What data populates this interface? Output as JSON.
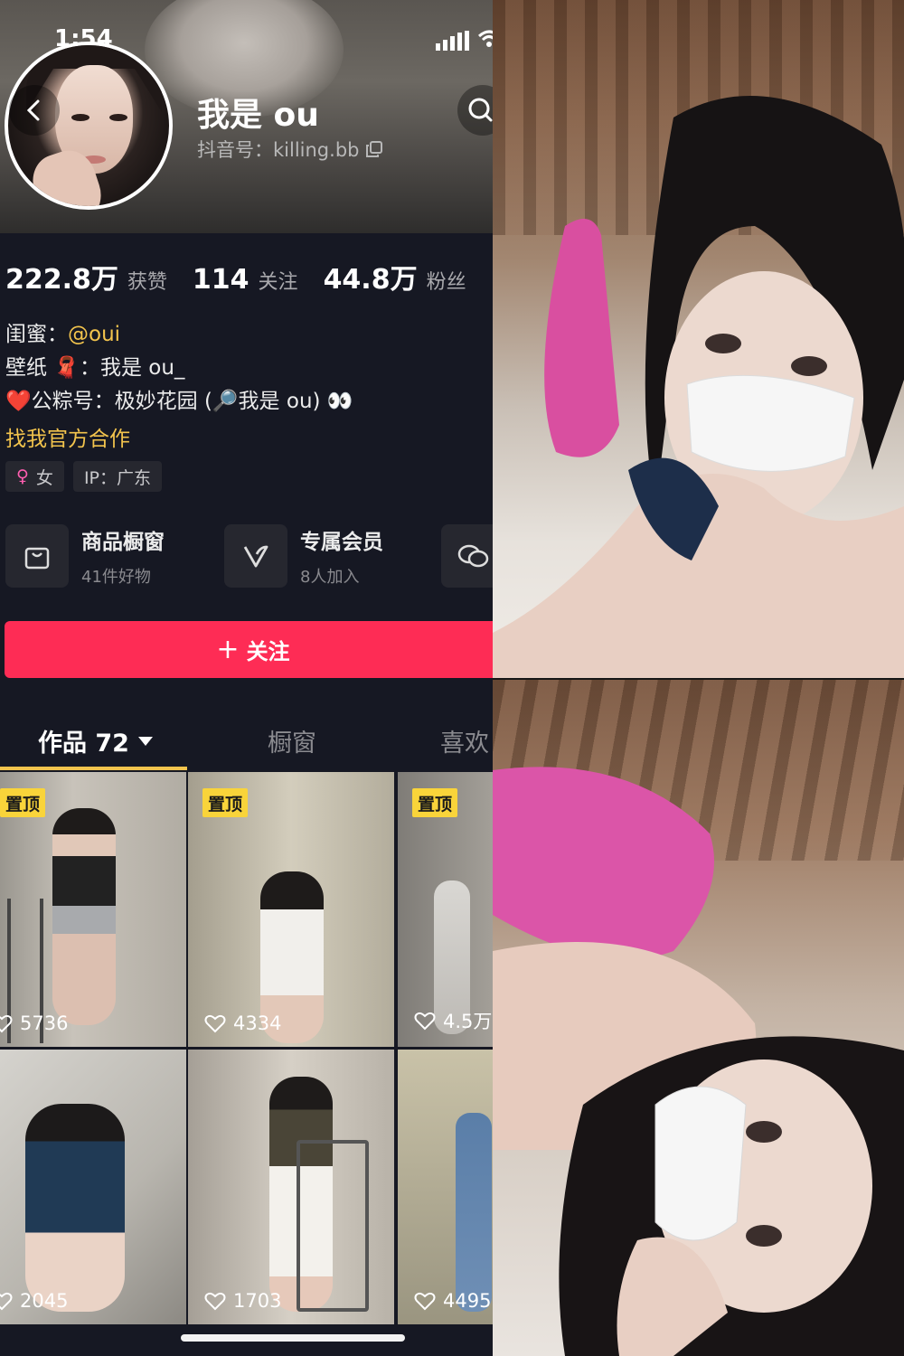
{
  "status_bar": {
    "time": "1:54"
  },
  "profile": {
    "nickname": "我是 ou",
    "douyin_id": "抖音号：killing.bb",
    "stats": [
      {
        "value": "222.8万",
        "label": "获赞"
      },
      {
        "value": "114",
        "label": "关注"
      },
      {
        "value": "44.8万",
        "label": "粉丝"
      }
    ],
    "bio": {
      "line1_prefix": "闺蜜：",
      "line1_mention": "@oui",
      "line2": "壁纸 🧣：我是 ou_",
      "line3": "❤️公粽号：极妙花园 (🔎我是 ou) 👀"
    },
    "contact_link": "找我官方合作",
    "tags": [
      {
        "icon": "female-icon",
        "label": "女"
      },
      {
        "label": "IP：广东"
      }
    ],
    "services": [
      {
        "icon": "shop-bag-icon",
        "title": "商品橱窗",
        "subtitle": "41件好物"
      },
      {
        "icon": "vip-v-icon",
        "title": "专属会员",
        "subtitle": "8人加入"
      }
    ],
    "follow_button": {
      "plus": "+",
      "label": "关注"
    }
  },
  "tabs": [
    {
      "label": "作品 72",
      "active": true
    },
    {
      "label": "橱窗",
      "active": false
    },
    {
      "label": "喜欢",
      "active": false
    }
  ],
  "videos": [
    {
      "pinned": "置顶",
      "likes": "5736"
    },
    {
      "pinned": "置顶",
      "likes": "4334"
    },
    {
      "pinned": "置顶",
      "likes": "4.5万"
    },
    {
      "likes": "2045"
    },
    {
      "likes": "1703"
    },
    {
      "likes": "4495"
    }
  ],
  "colors": {
    "accent_follow": "#fe2c55",
    "mention_yellow": "#f3c44d",
    "pin_badge": "#f9d43a"
  }
}
